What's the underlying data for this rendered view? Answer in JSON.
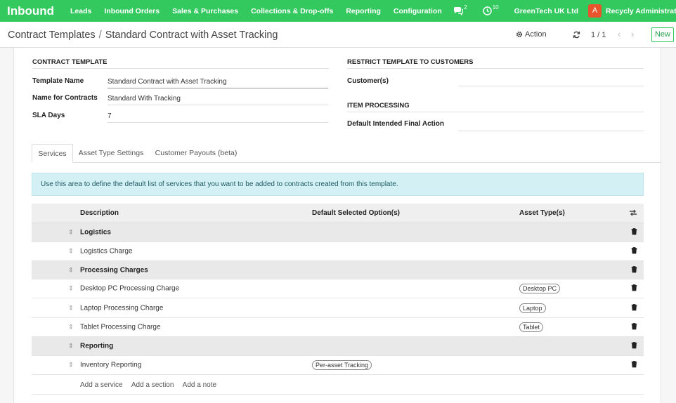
{
  "navbar": {
    "brand": "Inbound",
    "menu": [
      "Leads",
      "Inbound Orders",
      "Sales & Purchases",
      "Collections & Drop-offs",
      "Reporting",
      "Configuration"
    ],
    "messages_count": "2",
    "activities_count": "10",
    "company": "GreenTech UK Ltd",
    "avatar_letter": "A",
    "user": "Recycly Administrator",
    "accent_color": "#34c95f"
  },
  "control_panel": {
    "breadcrumb_parent": "Contract Templates",
    "breadcrumb_separator": "/",
    "breadcrumb_current": "Standard Contract with Asset Tracking",
    "action_label": "Action",
    "pager": "1 / 1",
    "new_label": "New"
  },
  "form": {
    "contract_template_title": "CONTRACT TEMPLATE",
    "fields": {
      "template_name_label": "Template Name",
      "template_name_value": "Standard Contract with Asset Tracking",
      "contract_name_label": "Name for Contracts",
      "contract_name_value": "Standard With Tracking",
      "sla_label": "SLA Days",
      "sla_value": "7"
    },
    "restrict_title": "RESTRICT TEMPLATE TO CUSTOMERS",
    "customers_label": "Customer(s)",
    "item_processing_title": "ITEM PROCESSING",
    "final_action_label": "Default Intended Final Action"
  },
  "tabs": [
    "Services",
    "Asset Type Settings",
    "Customer Payouts (beta)"
  ],
  "alert": "Use this area to define the default list of services that you want to be added to contracts created from this template.",
  "table": {
    "headers": {
      "description": "Description",
      "options": "Default Selected Option(s)",
      "asset_types": "Asset Type(s)"
    },
    "rows": [
      {
        "type": "section",
        "description": "Logistics"
      },
      {
        "type": "line",
        "description": "Logistics Charge"
      },
      {
        "type": "section",
        "description": "Processing Charges"
      },
      {
        "type": "line",
        "description": "Desktop PC Processing Charge",
        "asset_tag": "Desktop PC"
      },
      {
        "type": "line",
        "description": "Laptop Processing Charge",
        "asset_tag": "Laptop"
      },
      {
        "type": "line",
        "description": "Tablet Processing Charge",
        "asset_tag": "Tablet"
      },
      {
        "type": "section",
        "description": "Reporting"
      },
      {
        "type": "line",
        "description": "Inventory Reporting",
        "option_tag": "Per-asset Tracking"
      }
    ]
  },
  "add_links": {
    "add_service": "Add a service",
    "add_section": "Add a section",
    "add_note": "Add a note"
  }
}
